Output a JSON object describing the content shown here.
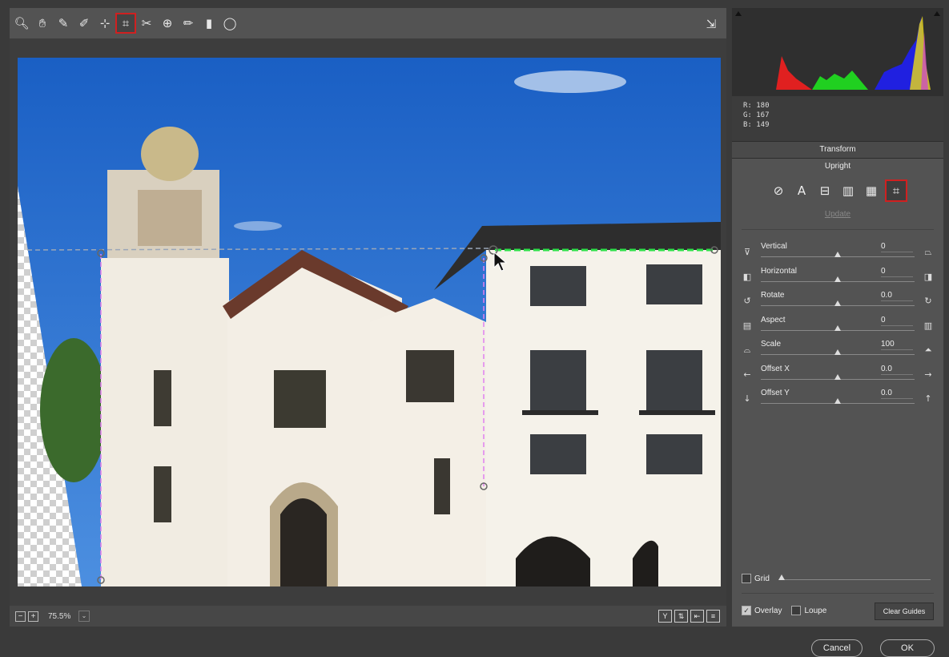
{
  "toolbar": {
    "tools": [
      {
        "name": "zoom-tool-icon",
        "glyph": "🔍︎"
      },
      {
        "name": "hand-tool-icon",
        "glyph": "✋︎"
      },
      {
        "name": "white-balance-tool-icon",
        "glyph": "✎"
      },
      {
        "name": "color-sampler-tool-icon",
        "glyph": "✐"
      },
      {
        "name": "targeted-adjustment-tool-icon",
        "glyph": "⊹"
      },
      {
        "name": "transform-tool-icon",
        "glyph": "⌗",
        "active": true
      },
      {
        "name": "spot-removal-tool-icon",
        "glyph": "✂"
      },
      {
        "name": "red-eye-tool-icon",
        "glyph": "⊕"
      },
      {
        "name": "adjustment-brush-icon",
        "glyph": "✏"
      },
      {
        "name": "graduated-filter-icon",
        "glyph": "▮"
      },
      {
        "name": "radial-filter-icon",
        "glyph": "◯"
      }
    ],
    "preview_toggle_icon": "toggle-fullscreen-icon"
  },
  "bottom_bar": {
    "zoom_out_glyph": "−",
    "zoom_in_glyph": "+",
    "zoom_value": "75.5%",
    "zoom_dropdown_glyph": "⌄",
    "view_icons": [
      {
        "name": "before-after-y-icon",
        "glyph": "Y"
      },
      {
        "name": "swap-before-after-icon",
        "glyph": "⇅"
      },
      {
        "name": "copy-settings-icon",
        "glyph": "⇤"
      },
      {
        "name": "preview-preferences-icon",
        "glyph": "≡"
      }
    ]
  },
  "info": {
    "r_label": "R:",
    "r_value": "180",
    "g_label": "G:",
    "g_value": "167",
    "b_label": "B:",
    "b_value": "149"
  },
  "panel": {
    "section_title": "Transform",
    "upright_label": "Upright",
    "update_label": "Update",
    "upright_buttons": [
      {
        "name": "upright-off-icon",
        "glyph": "⊘"
      },
      {
        "name": "upright-auto-icon",
        "glyph": "A"
      },
      {
        "name": "upright-level-icon",
        "glyph": "⊟"
      },
      {
        "name": "upright-vertical-icon",
        "glyph": "▥"
      },
      {
        "name": "upright-full-icon",
        "glyph": "▦"
      },
      {
        "name": "upright-guided-icon",
        "glyph": "⌗",
        "active": true
      }
    ],
    "sliders": [
      {
        "label": "Vertical",
        "value": "0",
        "position": 0.5,
        "left_icon": "⊽",
        "right_icon": "⏢",
        "left_name": "vertical-minus-icon",
        "right_name": "vertical-plus-icon"
      },
      {
        "label": "Horizontal",
        "value": "0",
        "position": 0.5,
        "left_icon": "◧",
        "right_icon": "◨",
        "left_name": "horizontal-minus-icon",
        "right_name": "horizontal-plus-icon"
      },
      {
        "label": "Rotate",
        "value": "0.0",
        "position": 0.5,
        "left_icon": "↺",
        "right_icon": "↻",
        "left_name": "rotate-left-icon",
        "right_name": "rotate-right-icon"
      },
      {
        "label": "Aspect",
        "value": "0",
        "position": 0.5,
        "left_icon": "▤",
        "right_icon": "▥",
        "left_name": "aspect-minus-icon",
        "right_name": "aspect-plus-icon"
      },
      {
        "label": "Scale",
        "value": "100",
        "position": 0.5,
        "left_icon": "⌓",
        "right_icon": "⏶",
        "left_name": "scale-minus-icon",
        "right_name": "scale-plus-icon"
      },
      {
        "label": "Offset X",
        "value": "0.0",
        "position": 0.5,
        "left_icon": "←",
        "right_icon": "→",
        "left_name": "offset-x-left-icon",
        "right_name": "offset-x-right-icon"
      },
      {
        "label": "Offset Y",
        "value": "0.0",
        "position": 0.5,
        "left_icon": "↓",
        "right_icon": "↑",
        "left_name": "offset-y-down-icon",
        "right_name": "offset-y-up-icon"
      }
    ],
    "grid_label": "Grid",
    "grid_checked": false,
    "grid_position": 0.0,
    "overlay_label": "Overlay",
    "overlay_checked": true,
    "loupe_label": "Loupe",
    "loupe_checked": false,
    "clear_guides_label": "Clear Guides"
  },
  "dialog": {
    "cancel_label": "Cancel",
    "ok_label": "OK"
  }
}
